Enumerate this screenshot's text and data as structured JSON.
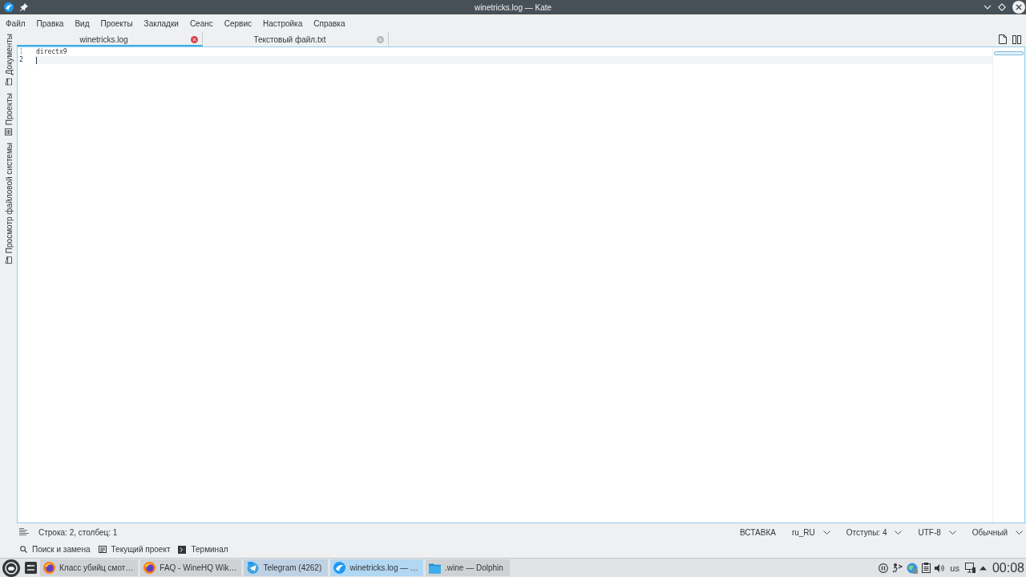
{
  "window": {
    "title": "winetricks.log — Kate"
  },
  "menu": [
    "Файл",
    "Правка",
    "Вид",
    "Проекты",
    "Закладки",
    "Сеанс",
    "Сервис",
    "Настройка",
    "Справка"
  ],
  "side_panel": [
    {
      "label": "Документы",
      "kind": "documents"
    },
    {
      "label": "Проекты",
      "kind": "projects"
    },
    {
      "label": "Просмотр файловой системы",
      "kind": "filesystem"
    }
  ],
  "tabs": [
    {
      "label": "winetricks.log",
      "selected": true
    },
    {
      "label": "Текстовый файл.txt",
      "selected": false
    }
  ],
  "editor": {
    "lines": [
      {
        "number": "1",
        "text": "directx9",
        "current": false
      },
      {
        "number": "2",
        "current": true
      }
    ]
  },
  "status_bar": {
    "position": "Строка: 2, столбец: 1",
    "mode": "ВСТАВКА",
    "dropdowns": [
      "ru_RU",
      "Отступы: 4",
      "UTF-8",
      "Обычный"
    ]
  },
  "tool_views": [
    {
      "label": "Поиск и замена",
      "kind": "search"
    },
    {
      "label": "Текущий проект",
      "kind": "project"
    },
    {
      "label": "Терминал",
      "kind": "terminal"
    }
  ],
  "taskbar": {
    "tasks": [
      {
        "label": "Класс убийц смот…",
        "kind": "browser",
        "selected": false,
        "attention": false
      },
      {
        "label": "FAQ - WineHQ Wik…",
        "kind": "browser",
        "selected": false,
        "attention": false
      },
      {
        "label": "Telegram (4262)",
        "kind": "messenger",
        "selected": false,
        "attention": true
      },
      {
        "label": "winetricks.log — …",
        "kind": "editor",
        "selected": true,
        "attention": false
      },
      {
        "label": ".wine — Dolphin",
        "kind": "files",
        "selected": false,
        "attention": false
      }
    ],
    "keyboard_layout": "us",
    "clock": "00:08"
  }
}
